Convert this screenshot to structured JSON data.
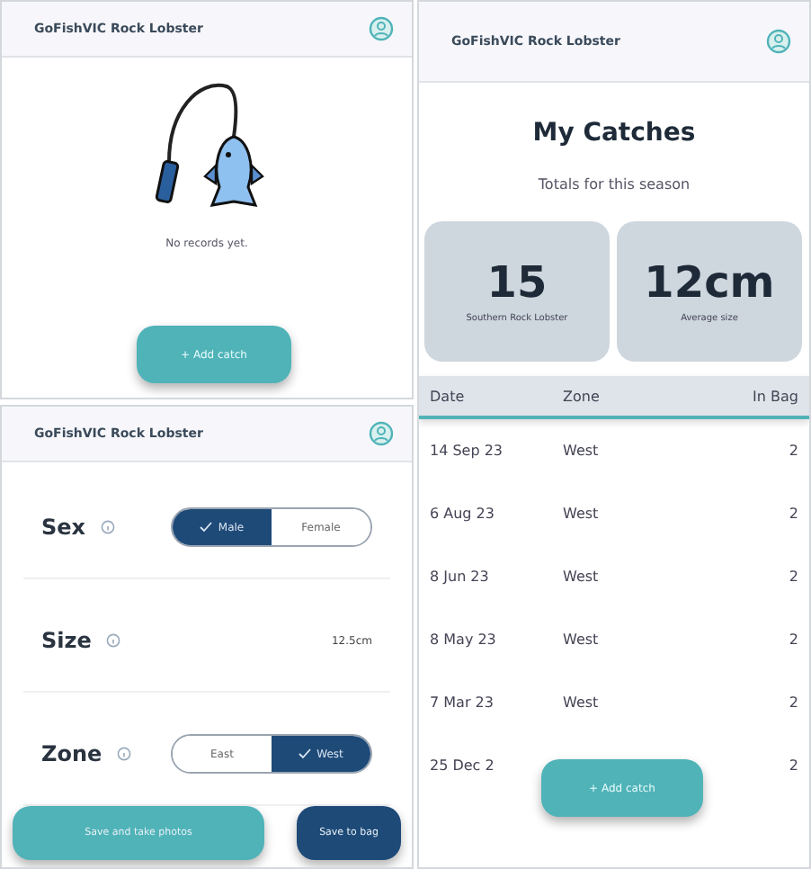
{
  "empty_screen": {
    "title": "GoFishVIC Rock Lobster",
    "message": "No records yet.",
    "add_button": "+ Add catch"
  },
  "form_screen": {
    "title": "GoFishVIC Rock Lobster",
    "fields": [
      {
        "kind": "toggle",
        "label": "Sex",
        "options": [
          {
            "label": "Male",
            "selected": true
          },
          {
            "label": "Female",
            "selected": false
          }
        ]
      },
      {
        "kind": "value",
        "label": "Size",
        "value": "12.5cm"
      },
      {
        "kind": "toggle",
        "label": "Zone",
        "options": [
          {
            "label": "East",
            "selected": false
          },
          {
            "label": "West",
            "selected": true
          }
        ]
      }
    ],
    "buttons": [
      {
        "kind": "secondary",
        "label": "Save and take photos"
      },
      {
        "kind": "primary",
        "label": "Save to bag"
      }
    ]
  },
  "list_screen": {
    "title": "GoFishVIC Rock Lobster",
    "heading": "My Catches",
    "subheading": "Totals for this season",
    "stats": [
      {
        "value": "15",
        "label": "Southern Rock Lobster"
      },
      {
        "value": "12cm",
        "label": "Average size"
      }
    ],
    "table": {
      "columns": [
        "Date",
        "Zone",
        "In Bag"
      ],
      "rows": [
        {
          "date": "14 Sep 23",
          "zone": "West",
          "in_bag": "2"
        },
        {
          "date": "6 Aug 23",
          "zone": "West",
          "in_bag": "2"
        },
        {
          "date": "8 Jun 23",
          "zone": "West",
          "in_bag": "2"
        },
        {
          "date": "8 May 23",
          "zone": "West",
          "in_bag": "2"
        },
        {
          "date": "7 Mar 23",
          "zone": "West",
          "in_bag": "2"
        },
        {
          "date": "25 Dec 2",
          "in_bag": "2"
        }
      ]
    },
    "add_button": "+ Add catch"
  }
}
